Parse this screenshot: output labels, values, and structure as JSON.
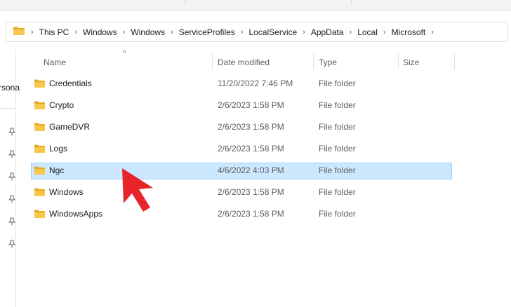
{
  "address_bar": {
    "path": [
      "This PC",
      "Windows",
      "Windows",
      "ServiceProfiles",
      "LocalService",
      "AppData",
      "Local",
      "Microsoft"
    ]
  },
  "nav_pane": {
    "clipped_label": "rsona"
  },
  "columns": {
    "name": "Name",
    "date_modified": "Date modified",
    "type": "Type",
    "size": "Size"
  },
  "files": [
    {
      "name": "Credentials",
      "date_modified": "11/20/2022 7:46 PM",
      "type": "File folder",
      "selected": false
    },
    {
      "name": "Crypto",
      "date_modified": "2/6/2023 1:58 PM",
      "type": "File folder",
      "selected": false
    },
    {
      "name": "GameDVR",
      "date_modified": "2/6/2023 1:58 PM",
      "type": "File folder",
      "selected": false
    },
    {
      "name": "Logs",
      "date_modified": "2/6/2023 1:58 PM",
      "type": "File folder",
      "selected": false
    },
    {
      "name": "Ngc",
      "date_modified": "4/6/2022 4:03 PM",
      "type": "File folder",
      "selected": true
    },
    {
      "name": "Windows",
      "date_modified": "2/6/2023 1:58 PM",
      "type": "File folder",
      "selected": false
    },
    {
      "name": "WindowsApps",
      "date_modified": "2/6/2023 1:58 PM",
      "type": "File folder",
      "selected": false
    }
  ],
  "icons": {
    "folder": "folder-icon",
    "pin": "pin-icon",
    "chevron": "chevron-right-icon",
    "sort": "sort-up-icon",
    "annotation": "red-arrow-pointer"
  },
  "colors": {
    "selection_bg": "#cce8ff",
    "selection_border": "#99d1ff",
    "folder_yellow": "#f8c64a",
    "annotation_red": "#e8242b"
  }
}
